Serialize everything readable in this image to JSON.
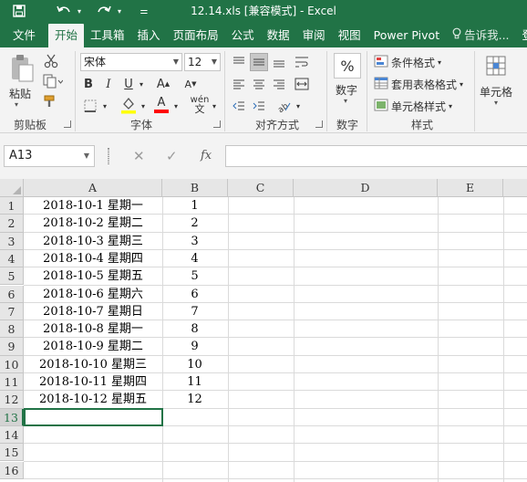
{
  "window": {
    "title": "12.14.xls  [兼容模式] - Excel"
  },
  "qat": {
    "save_icon": "save-icon",
    "undo_icon": "undo-icon",
    "redo_icon": "redo-icon",
    "customize_icon": "customize-qat-icon"
  },
  "tabs": [
    {
      "label": "文件"
    },
    {
      "label": "开始"
    },
    {
      "label": "工具箱"
    },
    {
      "label": "插入"
    },
    {
      "label": "页面布局"
    },
    {
      "label": "公式"
    },
    {
      "label": "数据"
    },
    {
      "label": "审阅"
    },
    {
      "label": "视图"
    },
    {
      "label": "Power Pivot"
    },
    {
      "label": "告诉我..."
    },
    {
      "label": "登"
    }
  ],
  "ribbon": {
    "clipboard": {
      "label": "剪贴板",
      "paste": "粘贴"
    },
    "font": {
      "label": "字体",
      "name": "宋体",
      "size": "12"
    },
    "alignment": {
      "label": "对齐方式"
    },
    "number": {
      "label": "数字",
      "percent": "%"
    },
    "styles": {
      "label": "样式",
      "conditional": "条件格式",
      "table": "套用表格格式",
      "cell_styles": "单元格样式"
    },
    "cells": {
      "label": "单元格"
    }
  },
  "formula_bar": {
    "name_box": "A13",
    "cancel": "✕",
    "enter": "✓",
    "fx": "fx",
    "value": ""
  },
  "grid": {
    "columns": [
      "A",
      "B",
      "C",
      "D",
      "E"
    ],
    "rows": [
      "1",
      "2",
      "3",
      "4",
      "5",
      "6",
      "7",
      "8",
      "9",
      "10",
      "11",
      "12",
      "13",
      "14",
      "15",
      "16"
    ],
    "selected_row": "13",
    "data": [
      {
        "a": "2018-10-1 星期一",
        "b": "1"
      },
      {
        "a": "2018-10-2 星期二",
        "b": "2"
      },
      {
        "a": "2018-10-3 星期三",
        "b": "3"
      },
      {
        "a": "2018-10-4 星期四",
        "b": "4"
      },
      {
        "a": "2018-10-5 星期五",
        "b": "5"
      },
      {
        "a": "2018-10-6 星期六",
        "b": "6"
      },
      {
        "a": "2018-10-7 星期日",
        "b": "7"
      },
      {
        "a": "2018-10-8 星期一",
        "b": "8"
      },
      {
        "a": "2018-10-9 星期二",
        "b": "9"
      },
      {
        "a": "2018-10-10 星期三",
        "b": "10"
      },
      {
        "a": "2018-10-11 星期四",
        "b": "11"
      },
      {
        "a": "2018-10-12 星期五",
        "b": "12"
      }
    ]
  },
  "colors": {
    "brand": "#217346",
    "ribbon_bg": "#f3f3f3",
    "header_bg": "#e6e6e6",
    "gridline": "#dadada"
  }
}
